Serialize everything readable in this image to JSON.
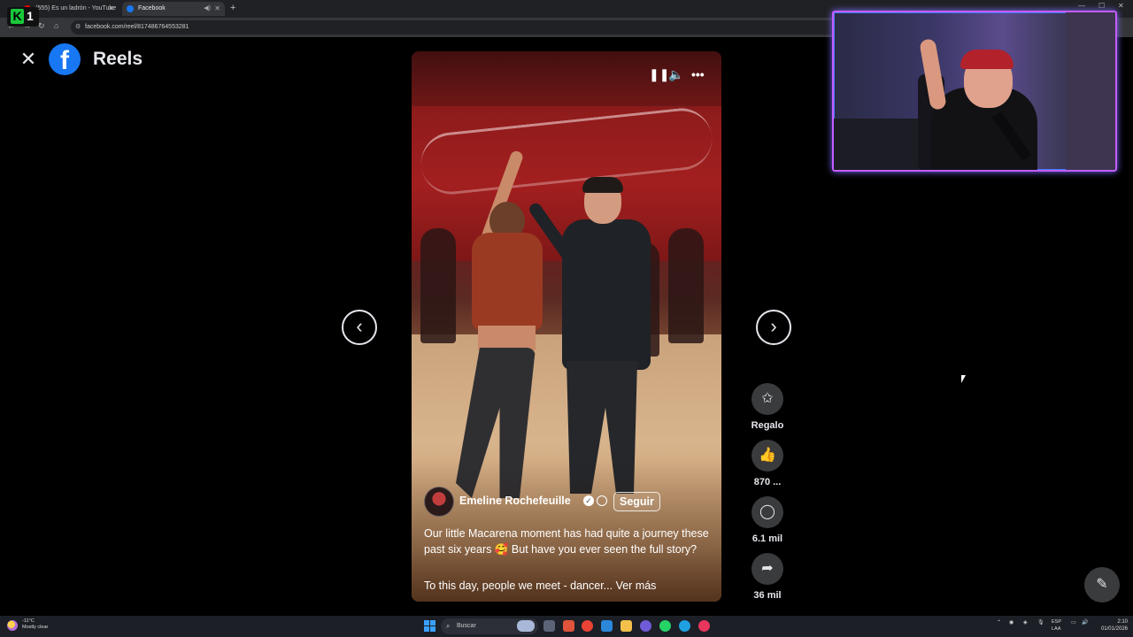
{
  "browser": {
    "tabs": [
      {
        "title": "(555) Es un ladrón - YouTube"
      },
      {
        "title": "Facebook"
      }
    ],
    "url": "facebook.com/reel/817486764553281",
    "overlay_logo": {
      "letter": "K",
      "number": "1"
    }
  },
  "page": {
    "title": "Reels"
  },
  "reel": {
    "author": "Emeline Rochefeuille",
    "follow_label": "Seguir",
    "caption": "Our little Macarena moment has had quite a journey these past six years 🥰 But have you ever seen the full story?",
    "caption_more": "To this day, people we meet - dancer...",
    "see_more_label": "Ver más"
  },
  "actions": {
    "gift_label": "Regalo",
    "likes": "870 ...",
    "comments": "6.1 mil",
    "shares": "36 mil"
  },
  "taskbar": {
    "weather_temp": "-11°C",
    "weather_desc": "Mostly clear",
    "search_placeholder": "Buscar",
    "lang_line1": "ESP",
    "lang_line2": "LAA",
    "time": "2:10",
    "date": "01/01/2026"
  },
  "colors": {
    "facebook_blue": "#1877f2",
    "webcam_border": "#c45cff"
  }
}
